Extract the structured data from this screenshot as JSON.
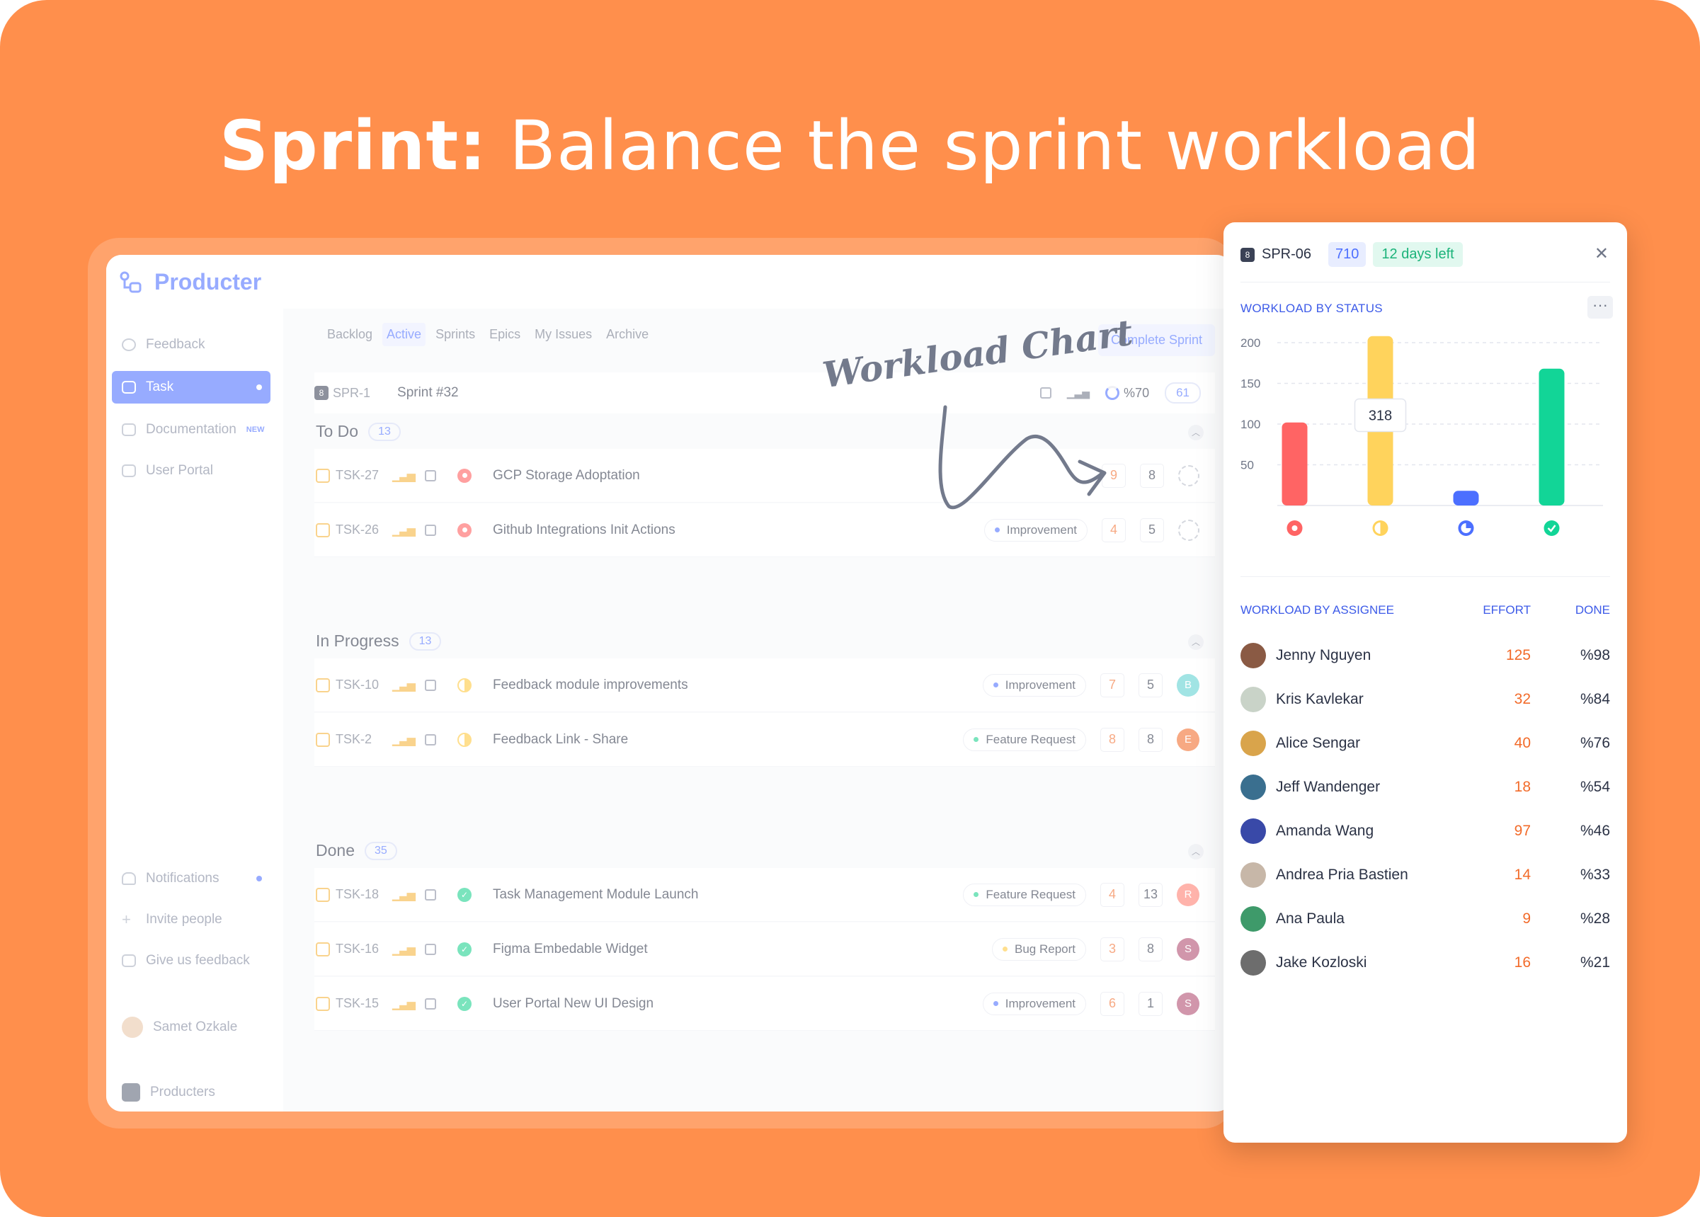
{
  "headline": {
    "bold": "Sprint:",
    "rest": " Balance the sprint workload"
  },
  "app": {
    "brand": "Producter",
    "sidebar": {
      "items": [
        {
          "label": "Feedback",
          "icon": "chat-bubble-icon"
        },
        {
          "label": "Task",
          "icon": "task-board-icon",
          "active": true
        },
        {
          "label": "Documentation",
          "icon": "document-icon",
          "badge": "NEW"
        },
        {
          "label": "User Portal",
          "icon": "laptop-icon"
        }
      ],
      "bottom": [
        {
          "label": "Notifications",
          "icon": "bell-icon"
        },
        {
          "label": "Invite people",
          "icon": "plus-icon"
        },
        {
          "label": "Give us feedback",
          "icon": "message-icon"
        }
      ],
      "user_name": "Samet Ozkale",
      "workspace": "Producters"
    },
    "tabs": [
      "Backlog",
      "Active",
      "Sprints",
      "Epics",
      "My Issues",
      "Archive"
    ],
    "active_tab": "Active",
    "complete_button": "Complete Sprint",
    "sprint": {
      "badge": "8",
      "id": "SPR-1",
      "name": "Sprint #32",
      "progress": "%70",
      "points": "61"
    },
    "groups": [
      {
        "title": "To Do",
        "count": "13",
        "tasks": [
          {
            "id": "TSK-27",
            "title": "GCP Storage Adoptation",
            "tag": "",
            "effort": "9",
            "points": "8",
            "assignee": ""
          },
          {
            "id": "TSK-26",
            "title": "Github Integrations Init Actions",
            "tag": "Improvement",
            "effort": "4",
            "points": "5",
            "assignee": ""
          }
        ]
      },
      {
        "title": "In Progress",
        "count": "13",
        "tasks": [
          {
            "id": "TSK-10",
            "title": "Feedback module improvements",
            "tag": "Improvement",
            "effort": "7",
            "points": "5",
            "assignee": "B"
          },
          {
            "id": "TSK-2",
            "title": "Feedback Link - Share",
            "tag": "Feature Request",
            "effort": "8",
            "points": "8",
            "assignee": "E"
          }
        ]
      },
      {
        "title": "Done",
        "count": "35",
        "tasks": [
          {
            "id": "TSK-18",
            "title": "Task Management Module Launch",
            "tag": "Feature Request",
            "effort": "4",
            "points": "13",
            "assignee": "R"
          },
          {
            "id": "TSK-16",
            "title": "Figma Embedable Widget",
            "tag": "Bug Report",
            "effort": "3",
            "points": "8",
            "assignee": "S"
          },
          {
            "id": "TSK-15",
            "title": "User Portal New UI Design",
            "tag": "Improvement",
            "effort": "6",
            "points": "1",
            "assignee": "S"
          }
        ]
      }
    ]
  },
  "annotation": "Workload Chart",
  "panel": {
    "badge": "8",
    "sprint_id": "SPR-06",
    "total": "710",
    "days_left": "12 days left",
    "close": "✕",
    "status_title": "WORKLOAD BY STATUS",
    "more": "···",
    "assignee_title": "WORKLOAD BY ASSIGNEE",
    "effort_label": "EFFORT",
    "done_label": "DONE",
    "assignees": [
      {
        "name": "Jenny Nguyen",
        "effort": "125",
        "done": "%98"
      },
      {
        "name": "Kris Kavlekar",
        "effort": "32",
        "done": "%84"
      },
      {
        "name": "Alice Sengar",
        "effort": "40",
        "done": "%76"
      },
      {
        "name": "Jeff Wandenger",
        "effort": "18",
        "done": "%54"
      },
      {
        "name": "Amanda Wang",
        "effort": "97",
        "done": "%46"
      },
      {
        "name": "Andrea Pria Bastien",
        "effort": "14",
        "done": "%33"
      },
      {
        "name": "Ana Paula",
        "effort": "9",
        "done": "%28"
      },
      {
        "name": "Jake Kozloski",
        "effort": "16",
        "done": "%21"
      }
    ]
  },
  "chart_data": {
    "type": "bar",
    "categories": [
      "To Do",
      "In Progress",
      "Review",
      "Done"
    ],
    "values": [
      102,
      208,
      18,
      168
    ],
    "colors": [
      "#FF6464",
      "#FFD35C",
      "#4C6FFF",
      "#12D597"
    ],
    "ylim": [
      0,
      200
    ],
    "yticks": [
      50,
      100,
      150,
      200
    ],
    "tooltip": "318",
    "grid": true
  },
  "colors": {
    "background": "#FF8F4C",
    "accent": "#4C6FFF",
    "effort": "#F26B2A"
  }
}
